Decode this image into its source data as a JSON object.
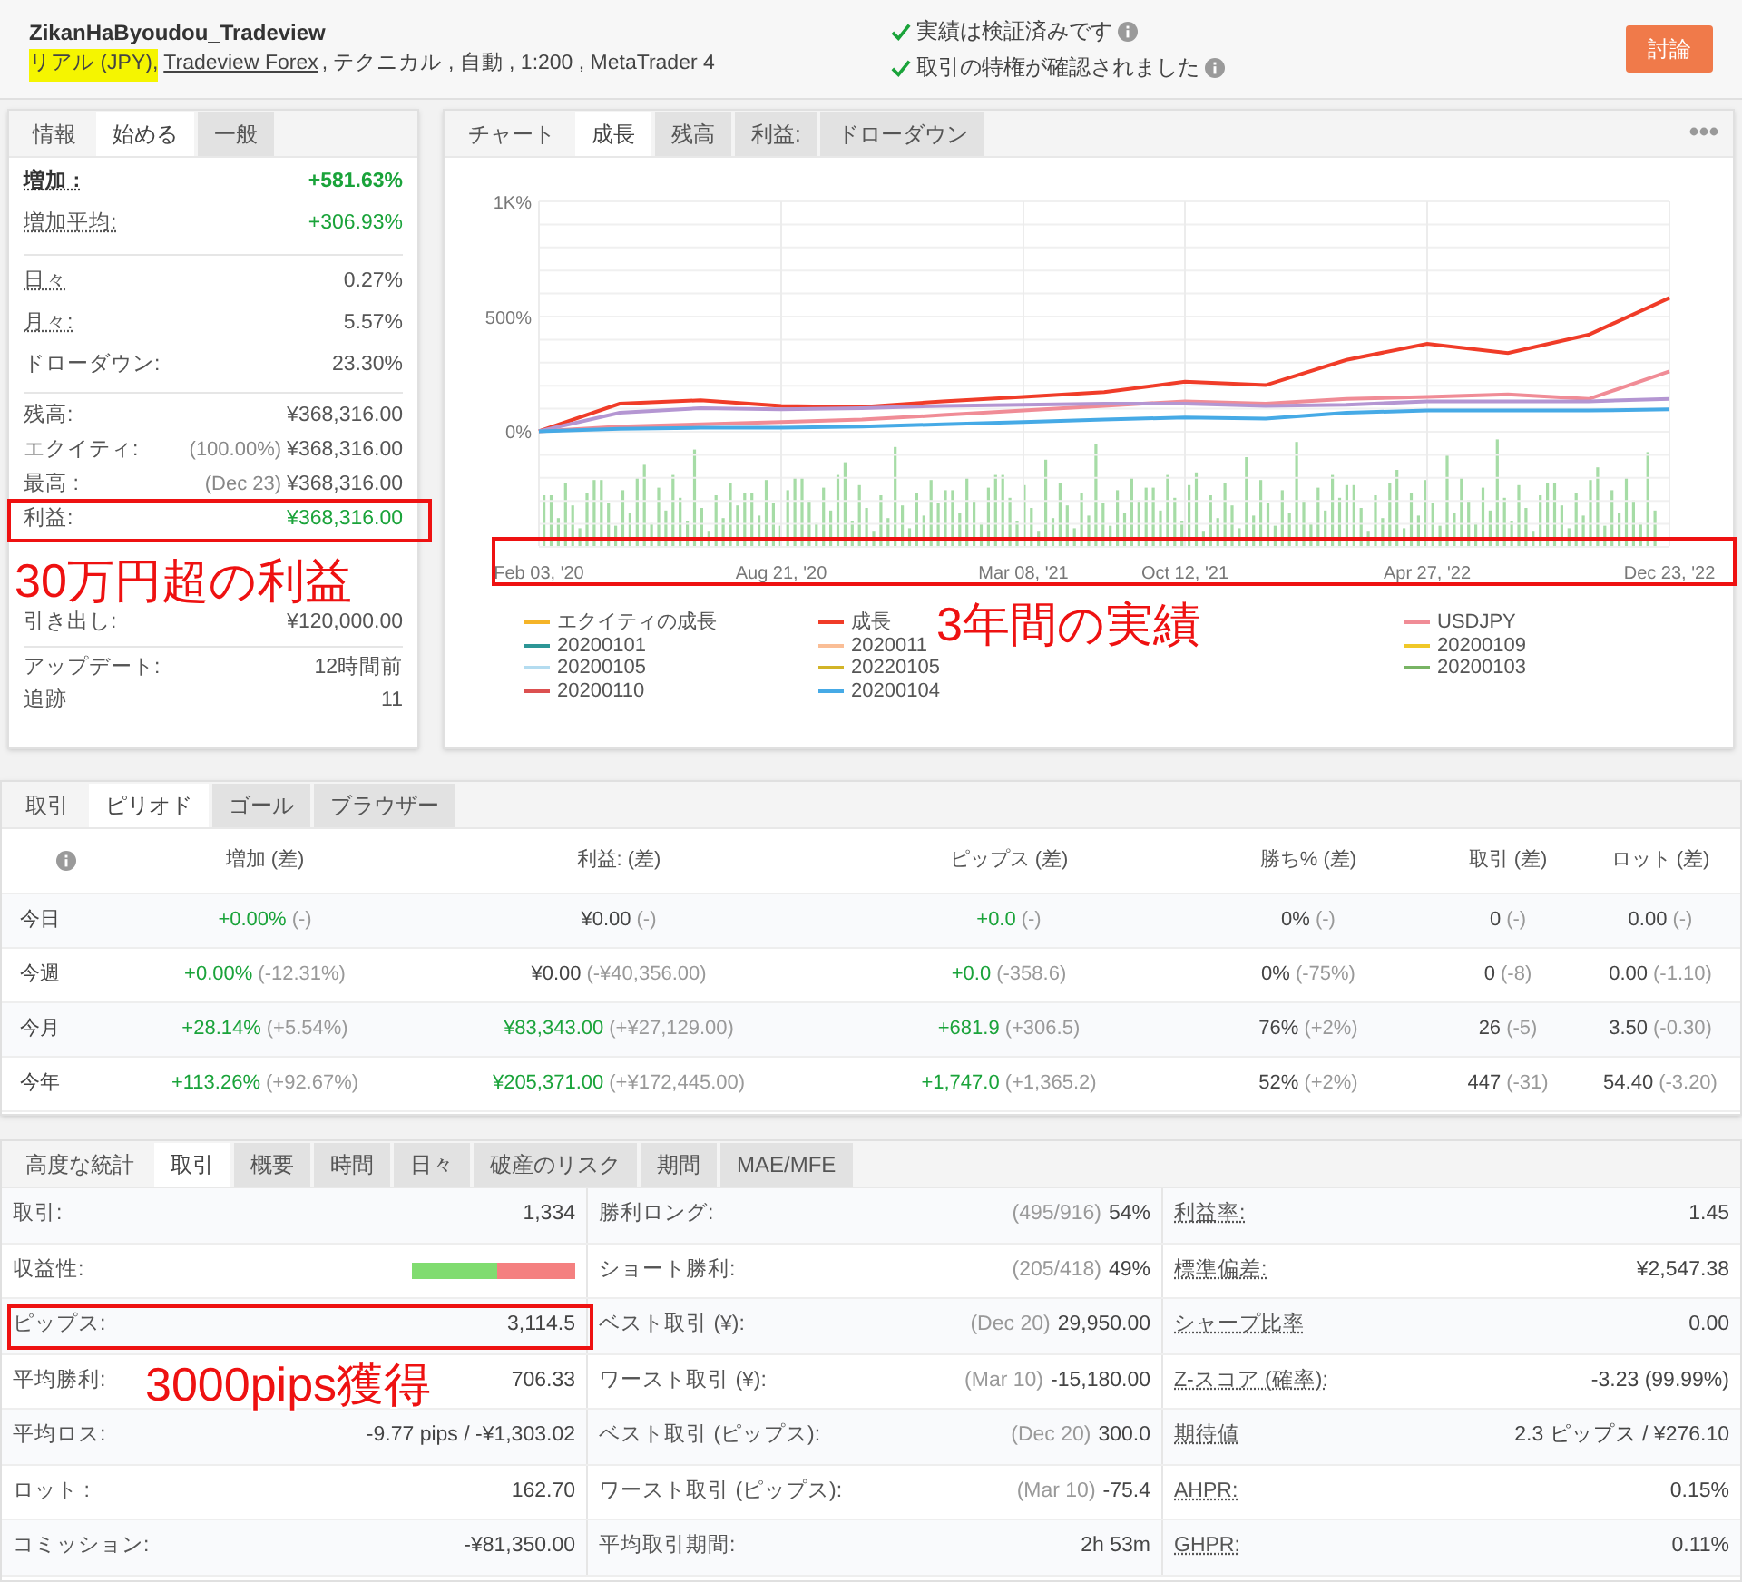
{
  "header": {
    "title": "ZikanHaByoudou_Tradeview",
    "subtitle": [
      {
        "kind": "highlight",
        "text": "リアル (JPY),"
      },
      {
        "kind": "link",
        "text": "Tradeview Forex"
      },
      {
        "kind": "text",
        "text": ", テクニカル , 自動 , 1:200 , MetaTrader 4"
      }
    ],
    "checks": [
      "実績は検証済みです",
      "取引の特権が確認されました"
    ],
    "button": "討論"
  },
  "info_panel": {
    "tabs": [
      {
        "label": "情報",
        "kind": "heading",
        "selected": false
      },
      {
        "label": "始める",
        "kind": "tab",
        "selected": true
      },
      {
        "label": "一般",
        "kind": "tab",
        "selected": false
      }
    ],
    "groups": [
      [
        {
          "kind": "row",
          "label": "増加 :",
          "hint": true,
          "value": "+581.63%",
          "positive": true,
          "strong": true
        },
        {
          "kind": "row",
          "label": "増加平均:",
          "hint": true,
          "value": "+306.93%",
          "positive": true,
          "strong": false
        }
      ],
      [
        {
          "kind": "row",
          "label": "日々",
          "hint": true,
          "value": "0.27%",
          "positive": false,
          "strong": false
        },
        {
          "kind": "row",
          "label": "月々:",
          "hint": true,
          "value": "5.57%",
          "positive": false,
          "strong": false
        },
        {
          "kind": "row",
          "label": "ドローダウン:",
          "hint": false,
          "value": "23.30%",
          "positive": false,
          "strong": false
        }
      ],
      [
        {
          "kind": "row",
          "label": "残高:",
          "hint": false,
          "value": "¥368,316.00",
          "positive": false,
          "strong": false
        },
        {
          "kind": "row",
          "label": "エクイティ:",
          "hint": false,
          "note": "(100.00%)",
          "value": "¥368,316.00",
          "positive": false,
          "strong": false
        },
        {
          "kind": "row",
          "label": "最高 :",
          "hint": false,
          "note": "(Dec 23)",
          "value": "¥368,316.00",
          "positive": false,
          "strong": false
        },
        {
          "kind": "row",
          "label": "利益:",
          "hint": false,
          "value": "¥368,316.00",
          "positive": true,
          "strong": false
        },
        {
          "kind": "covered"
        },
        {
          "kind": "covered"
        },
        {
          "kind": "row",
          "label": "引き出し:",
          "hint": false,
          "value": "¥120,000.00",
          "positive": false,
          "strong": false
        }
      ],
      [
        {
          "kind": "row",
          "label": "アップデート:",
          "hint": false,
          "value": "12時間前",
          "positive": false,
          "strong": false
        },
        {
          "kind": "row",
          "label": "追跡",
          "hint": false,
          "value": "11",
          "positive": false,
          "strong": false
        }
      ]
    ]
  },
  "chart_panel": {
    "tabs": [
      {
        "label": "チャート",
        "kind": "heading",
        "selected": false
      },
      {
        "label": "成長",
        "kind": "tab",
        "selected": true
      },
      {
        "label": "残高",
        "kind": "tab",
        "selected": false
      },
      {
        "label": "利益:",
        "kind": "tab",
        "selected": false
      },
      {
        "label": "ドローダウン",
        "kind": "tab",
        "selected": false
      }
    ],
    "chart_data": {
      "type": "line",
      "grid": true,
      "categories": [
        "Feb 03, '20",
        null,
        null,
        "Aug 21, '20",
        null,
        null,
        "Mar 08, '21",
        null,
        "Oct 12, '21",
        null,
        null,
        "Apr 27, '22",
        null,
        null,
        "Dec 23, '22"
      ],
      "ylim": [
        -500,
        1000
      ],
      "yticks": [
        {
          "value": 1000,
          "label": "1K%"
        },
        {
          "value": 500,
          "label": "500%"
        },
        {
          "value": 0,
          "label": "0%"
        }
      ],
      "series": [
        {
          "color": "#f03c28",
          "values": [
            0,
            120,
            135,
            110,
            105,
            130,
            150,
            170,
            215,
            200,
            310,
            380,
            340,
            420,
            580
          ]
        },
        {
          "color": "#f08c96",
          "values": [
            0,
            20,
            30,
            40,
            50,
            70,
            90,
            110,
            130,
            120,
            140,
            150,
            160,
            140,
            260
          ]
        },
        {
          "color": "#b496d2",
          "values": [
            0,
            80,
            100,
            95,
            100,
            110,
            115,
            120,
            120,
            110,
            115,
            130,
            130,
            130,
            140
          ]
        },
        {
          "color": "#46aae6",
          "values": [
            0,
            10,
            15,
            15,
            20,
            30,
            40,
            50,
            60,
            55,
            80,
            90,
            90,
            90,
            95
          ]
        }
      ]
    },
    "legend": [
      [
        {
          "kind": "item",
          "name": "エクイティの成長",
          "color": "#f5b428"
        },
        {
          "kind": "item",
          "name": "20200101",
          "color": "#2d9696"
        },
        {
          "kind": "item",
          "name": "20200105",
          "color": "#b4dcf0"
        },
        {
          "kind": "item",
          "name": "20200110",
          "color": "#dc5050"
        }
      ],
      [
        {
          "kind": "item",
          "name": "成長",
          "color": "#f03c28"
        },
        {
          "kind": "item",
          "name": "2020011",
          "color": "#fabe96"
        },
        {
          "kind": "item",
          "name": "20220105",
          "color": "#d2b428"
        },
        {
          "kind": "item",
          "name": "20200104",
          "color": "#46aae6"
        }
      ],
      [
        {
          "kind": "item",
          "name": "USDJPY",
          "color": "#f08c96"
        },
        {
          "kind": "item",
          "name": "20200109",
          "color": "#f0c828"
        },
        {
          "kind": "item",
          "name": "20200103",
          "color": "#78b464"
        }
      ]
    ]
  },
  "period": {
    "tabs": [
      {
        "label": "取引",
        "kind": "heading",
        "selected": false
      },
      {
        "label": "ピリオド",
        "kind": "tab",
        "selected": true
      },
      {
        "label": "ゴール",
        "kind": "tab",
        "selected": false
      },
      {
        "label": "ブラウザー",
        "kind": "tab",
        "selected": false
      }
    ],
    "columns": [
      "増加 (差)",
      "利益: (差)",
      "ピップス (差)",
      "勝ち% (差)",
      "取引 (差)",
      "ロット (差)"
    ],
    "rows": [
      {
        "label": "今日",
        "cells": [
          {
            "value": "+0.00%",
            "diff": "(-)",
            "positive": true
          },
          {
            "value": "¥0.00",
            "diff": "(-)",
            "positive": false
          },
          {
            "value": "+0.0",
            "diff": "(-)",
            "positive": true
          },
          {
            "value": "0%",
            "diff": "(-)",
            "positive": false
          },
          {
            "value": "0",
            "diff": "(-)",
            "positive": false
          },
          {
            "value": "0.00",
            "diff": "(-)",
            "positive": false
          }
        ]
      },
      {
        "label": "今週",
        "cells": [
          {
            "value": "+0.00%",
            "diff": "(-12.31%)",
            "positive": true
          },
          {
            "value": "¥0.00",
            "diff": "(-¥40,356.00)",
            "positive": false
          },
          {
            "value": "+0.0",
            "diff": "(-358.6)",
            "positive": true
          },
          {
            "value": "0%",
            "diff": "(-75%)",
            "positive": false
          },
          {
            "value": "0",
            "diff": "(-8)",
            "positive": false
          },
          {
            "value": "0.00",
            "diff": "(-1.10)",
            "positive": false
          }
        ]
      },
      {
        "label": "今月",
        "cells": [
          {
            "value": "+28.14%",
            "diff": "(+5.54%)",
            "positive": true
          },
          {
            "value": "¥83,343.00",
            "diff": "(+¥27,129.00)",
            "positive": true
          },
          {
            "value": "+681.9",
            "diff": "(+306.5)",
            "positive": true
          },
          {
            "value": "76%",
            "diff": "(+2%)",
            "positive": false
          },
          {
            "value": "26",
            "diff": "(-5)",
            "positive": false
          },
          {
            "value": "3.50",
            "diff": "(-0.30)",
            "positive": false
          }
        ]
      },
      {
        "label": "今年",
        "cells": [
          {
            "value": "+113.26%",
            "diff": "(+92.67%)",
            "positive": true
          },
          {
            "value": "¥205,371.00",
            "diff": "(+¥172,445.00)",
            "positive": true
          },
          {
            "value": "+1,747.0",
            "diff": "(+1,365.2)",
            "positive": true
          },
          {
            "value": "52%",
            "diff": "(+2%)",
            "positive": false
          },
          {
            "value": "447",
            "diff": "(-31)",
            "positive": false
          },
          {
            "value": "54.40",
            "diff": "(-3.20)",
            "positive": false
          }
        ]
      }
    ]
  },
  "stats": {
    "tabs": [
      {
        "label": "高度な統計",
        "kind": "heading",
        "selected": false
      },
      {
        "label": "取引",
        "kind": "tab",
        "selected": true
      },
      {
        "label": "概要",
        "kind": "tab",
        "selected": false
      },
      {
        "label": "時間",
        "kind": "tab",
        "selected": false
      },
      {
        "label": "日々",
        "kind": "tab",
        "selected": false
      },
      {
        "label": "破産のリスク",
        "kind": "tab",
        "selected": false
      },
      {
        "label": "期間",
        "kind": "tab",
        "selected": false
      },
      {
        "label": "MAE/MFE",
        "kind": "tab",
        "selected": false
      }
    ],
    "columns": [
      [
        {
          "kind": "text",
          "label": "取引:",
          "hint": false,
          "value": "1,334"
        },
        {
          "kind": "bar",
          "label": "収益性:",
          "hint": false,
          "level": 0.52
        },
        {
          "kind": "text",
          "label": "ピップス:",
          "hint": false,
          "value": "3,114.5"
        },
        {
          "kind": "text",
          "label": "平均勝利:",
          "hint": false,
          "value": "706.33"
        },
        {
          "kind": "text",
          "label": "平均ロス:",
          "hint": false,
          "value": "-9.77 pips / -¥1,303.02"
        },
        {
          "kind": "text",
          "label": "ロット :",
          "hint": false,
          "value": "162.70"
        },
        {
          "kind": "text",
          "label": "コミッション:",
          "hint": false,
          "value": "-¥81,350.00"
        }
      ],
      [
        {
          "kind": "text",
          "label": "勝利ロング:",
          "hint": false,
          "note": "(495/916)",
          "value": "54%"
        },
        {
          "kind": "text",
          "label": "ショート勝利:",
          "hint": false,
          "note": "(205/418)",
          "value": "49%"
        },
        {
          "kind": "text",
          "label": "ベスト取引 (¥):",
          "hint": false,
          "note": "(Dec 20)",
          "value": "29,950.00"
        },
        {
          "kind": "text",
          "label": "ワースト取引 (¥):",
          "hint": false,
          "note": "(Mar 10)",
          "value": "-15,180.00"
        },
        {
          "kind": "text",
          "label": "ベスト取引 (ピップス):",
          "hint": false,
          "note": "(Dec 20)",
          "value": "300.0"
        },
        {
          "kind": "text",
          "label": "ワースト取引 (ピップス):",
          "hint": false,
          "note": "(Mar 10)",
          "value": "-75.4"
        },
        {
          "kind": "text",
          "label": "平均取引期間:",
          "hint": false,
          "value": "2h 53m"
        }
      ],
      [
        {
          "kind": "text",
          "label": "利益率:",
          "hint": true,
          "value": "1.45"
        },
        {
          "kind": "text",
          "label": "標準偏差:",
          "hint": true,
          "value": "¥2,547.38"
        },
        {
          "kind": "text",
          "label": "シャープ比率",
          "hint": true,
          "value": "0.00"
        },
        {
          "kind": "text",
          "label": "Z-スコア (確率):",
          "hint": true,
          "value": "-3.23 (99.99%)"
        },
        {
          "kind": "text",
          "label": "期待値",
          "hint": true,
          "value": "2.3 ピップス / ¥276.10"
        },
        {
          "kind": "text",
          "label": "AHPR:",
          "hint": true,
          "value": "0.15%"
        },
        {
          "kind": "text",
          "label": "GHPR:",
          "hint": true,
          "value": "0.11%"
        }
      ]
    ]
  },
  "annotations": [
    {
      "text": "30万円超の利益"
    },
    {
      "text": "3年間の実績"
    },
    {
      "text": "3000pips獲得"
    }
  ]
}
